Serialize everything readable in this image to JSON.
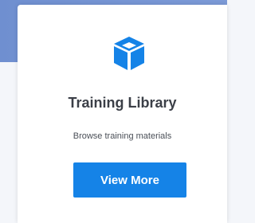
{
  "card": {
    "icon": "cube-icon",
    "title": "Training Library",
    "subtitle": "Browse training materials",
    "button_label": "View More"
  },
  "colors": {
    "header_blue": "#6f8fd0",
    "accent_blue": "#1583e7",
    "text_dark": "#3b3f47"
  }
}
